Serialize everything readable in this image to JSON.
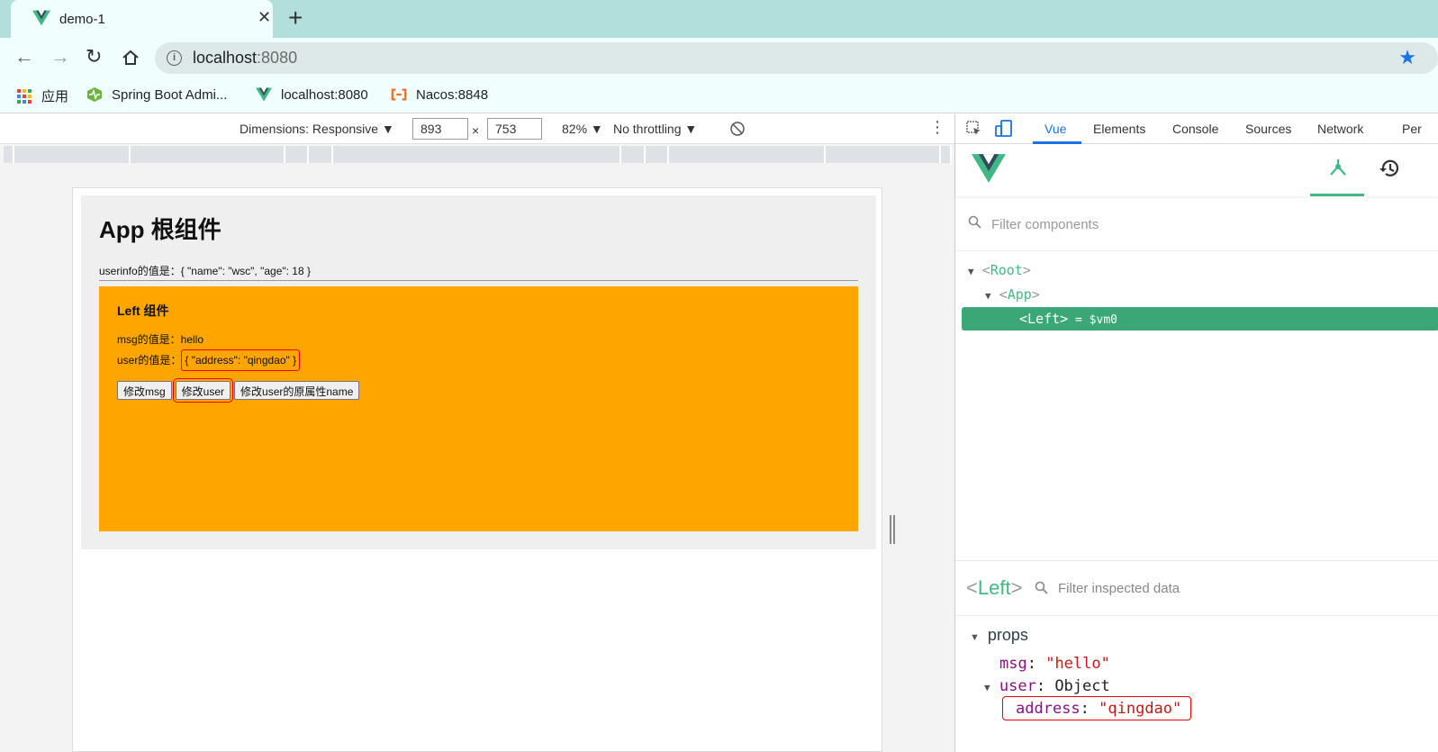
{
  "browser": {
    "tab_title": "demo-1",
    "url_host": "localhost",
    "url_port": ":8080",
    "bookmarks": [
      {
        "label": "应用",
        "icon": "apps-grid-icon"
      },
      {
        "label": "Spring Boot Admi...",
        "icon": "spring-boot-admin-icon"
      },
      {
        "label": "localhost:8080",
        "icon": "vue-logo-icon"
      },
      {
        "label": "Nacos:8848",
        "icon": "nacos-icon"
      }
    ]
  },
  "device_toolbar": {
    "dimensions_label": "Dimensions: Responsive ▼",
    "width": "893",
    "times": "×",
    "height": "753",
    "zoom": "82% ▼",
    "throttling": "No throttling ▼"
  },
  "page": {
    "app_title": "App 根组件",
    "userinfo_text": "userinfo的值是：{ \"name\": \"wsc\", \"age\": 18 }",
    "left_title": "Left 组件",
    "msg_label": "msg的值是：",
    "msg_value": "hello",
    "user_label": "user的值是：",
    "user_value": "{ \"address\": \"qingdao\" }",
    "buttons": [
      "修改msg",
      "修改user",
      "修改user的原属性name"
    ]
  },
  "devtools": {
    "tabs": [
      "Vue",
      "Elements",
      "Console",
      "Sources",
      "Network",
      "Per"
    ],
    "active_tab": "Vue",
    "filter_components_placeholder": "Filter components",
    "tree": {
      "root": "Root",
      "app": "App",
      "left": "Left",
      "left_suffix": " = $vm0"
    },
    "inspector": {
      "component": "Left",
      "filter_placeholder": "Filter inspected data",
      "section": "props",
      "msg_key": "msg",
      "msg_value": "\"hello\"",
      "user_key": "user",
      "user_value": "Object",
      "address_key": "address",
      "address_value": "\"qingdao\""
    }
  },
  "colors": {
    "accent": "#1a73e8",
    "vue_green": "#42b983",
    "left_bg": "#ffa500",
    "highlight": "#ff0000"
  }
}
